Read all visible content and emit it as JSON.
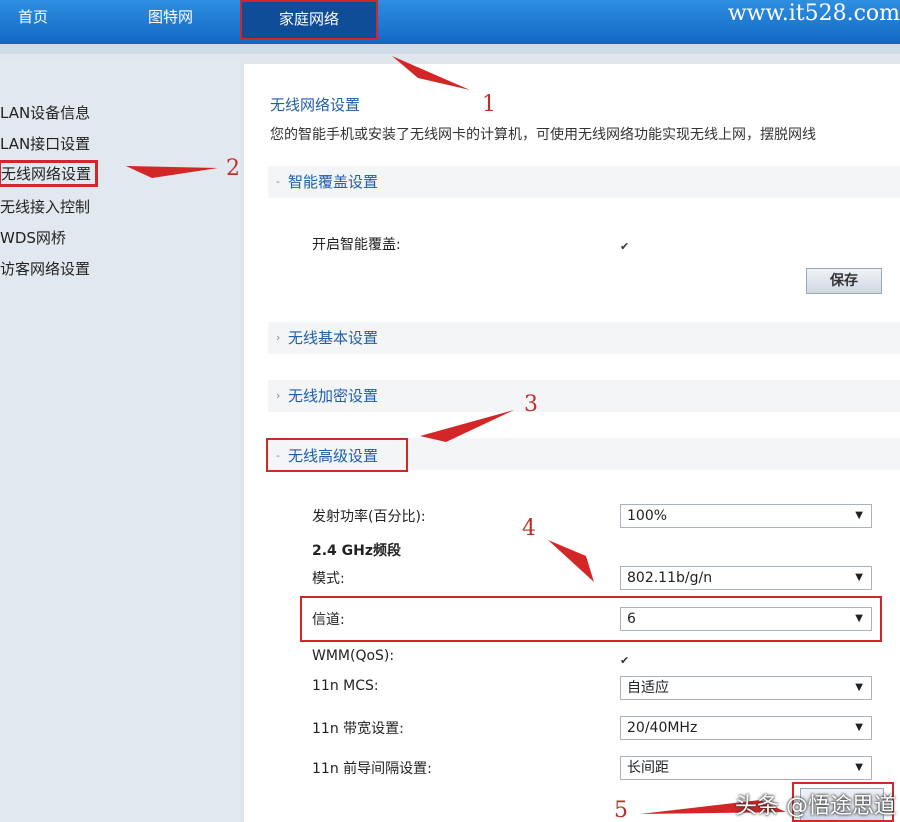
{
  "nav": {
    "items": [
      "首页",
      "图特网",
      "家庭网络"
    ],
    "site": "www.it528.com"
  },
  "sidebar": {
    "items": [
      "LAN设备信息",
      "LAN接口设置",
      "无线网络设置",
      "无线接入控制",
      "WDS网桥",
      "访客网络设置"
    ]
  },
  "content": {
    "title": "无线网络设置",
    "desc": "您的智能手机或安装了无线网卡的计算机，可使用无线网络功能实现无线上网，摆脱网线",
    "sections": {
      "smart": "智能覆盖设置",
      "basic": "无线基本设置",
      "encrypt": "无线加密设置",
      "advanced": "无线高级设置"
    },
    "smart_enable_label": "开启智能覆盖:",
    "save_label": "保存",
    "fields": {
      "power_label": "发射功率(百分比):",
      "power_value": "100%",
      "band_label": "2.4 GHz频段",
      "mode_label": "模式:",
      "mode_value": "802.11b/g/n",
      "channel_label": "信道:",
      "channel_value": "6",
      "wmm_label": "WMM(QoS):",
      "mcs_label": "11n MCS:",
      "mcs_value": "自适应",
      "bw_label": "11n 带宽设置:",
      "bw_value": "20/40MHz",
      "gi_label": "11n 前导间隔设置:",
      "gi_value": "长间距"
    }
  },
  "annotations": [
    "1",
    "2",
    "3",
    "4",
    "5"
  ],
  "watermark": "头条 @悟途思道",
  "colors": {
    "accent_blue": "#1168c4",
    "annotation_red": "#d32626"
  }
}
